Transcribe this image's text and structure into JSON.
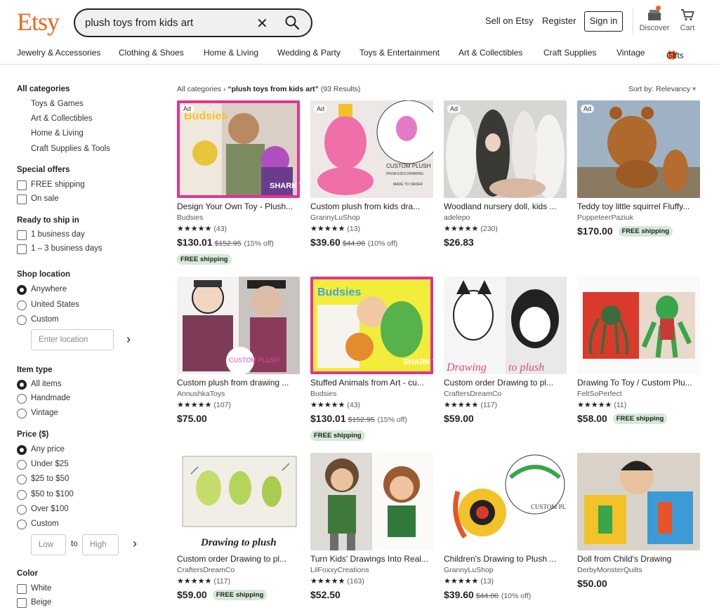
{
  "header": {
    "logo": "Etsy",
    "search_value": "plush toys from kids art",
    "sell": "Sell on Etsy",
    "register": "Register",
    "signin": "Sign in",
    "discover": "Discover",
    "cart": "Cart"
  },
  "catnav": [
    "Jewelry & Accessories",
    "Clothing & Shoes",
    "Home & Living",
    "Wedding & Party",
    "Toys & Entertainment",
    "Art & Collectibles",
    "Craft Supplies",
    "Vintage",
    "Gifts"
  ],
  "sidebar": {
    "all_categories": "All categories",
    "categories": [
      "Toys & Games",
      "Art & Collectibles",
      "Home & Living",
      "Craft Supplies & Tools"
    ],
    "special_offers": "Special offers",
    "offers": [
      "FREE shipping",
      "On sale"
    ],
    "ready_to_ship": "Ready to ship in",
    "ship_opts": [
      "1 business day",
      "1 – 3 business days"
    ],
    "shop_location": "Shop location",
    "locations": [
      "Anywhere",
      "United States",
      "Custom"
    ],
    "location_placeholder": "Enter location",
    "item_type": "Item type",
    "types": [
      "All items",
      "Handmade",
      "Vintage"
    ],
    "price": "Price ($)",
    "prices": [
      "Any price",
      "Under $25",
      "$25 to $50",
      "$50 to $100",
      "Over $100",
      "Custom"
    ],
    "low_placeholder": "Low",
    "to": "to",
    "high_placeholder": "High",
    "color": "Color",
    "colors": [
      "White",
      "Beige"
    ]
  },
  "results": {
    "crumb_root": "All categories",
    "crumb_query": "“plush toys from kids art”",
    "crumb_count": "(93 Results)",
    "sort": "Sort by: Relevancy"
  },
  "products": [
    {
      "ad": true,
      "title": "Design Your Own Toy - Plush...",
      "shop": "Budsies",
      "stars": "★★★★★",
      "reviews": "(43)",
      "price": "$130.01",
      "orig": "$152.95",
      "off": "(15% off)",
      "free": true,
      "free_below": true
    },
    {
      "ad": true,
      "title": "Custom plush from kids dra...",
      "shop": "GrannyLuShop",
      "stars": "★★★★★",
      "reviews": "(13)",
      "price": "$39.60",
      "orig": "$44.00",
      "off": "(10% off)",
      "free": false
    },
    {
      "ad": true,
      "title": "Woodland nursery doll, kids ...",
      "shop": "adelepo",
      "stars": "★★★★★",
      "reviews": "(230)",
      "price": "$26.83",
      "orig": "",
      "off": "",
      "free": false
    },
    {
      "ad": true,
      "title": "Teddy toy little squirrel Fluffy...",
      "shop": "PuppeteerPaziuk",
      "stars": "",
      "reviews": "",
      "price": "$170.00",
      "orig": "",
      "off": "",
      "free": true,
      "free_below": false
    },
    {
      "ad": false,
      "title": "Custom plush from drawing ...",
      "shop": "AnnushkaToys",
      "stars": "★★★★★",
      "reviews": "(107)",
      "price": "$75.00",
      "orig": "",
      "off": "",
      "free": false
    },
    {
      "ad": false,
      "title": "Stuffed Animals from Art - cu...",
      "shop": "Budsies",
      "stars": "★★★★★",
      "reviews": "(43)",
      "price": "$130.01",
      "orig": "$152.95",
      "off": "(15% off)",
      "free": true,
      "free_below": true
    },
    {
      "ad": false,
      "title": "Custom order Drawing to pl...",
      "shop": "CraftersDreamCo",
      "stars": "★★★★★",
      "reviews": "(117)",
      "price": "$59.00",
      "orig": "",
      "off": "",
      "free": false
    },
    {
      "ad": false,
      "title": "Drawing To Toy / Custom Plu...",
      "shop": "FeltSoPerfect",
      "stars": "★★★★★",
      "reviews": "(11)",
      "price": "$58.00",
      "orig": "",
      "off": "",
      "free": true,
      "free_below": false
    },
    {
      "ad": false,
      "title": "Custom order Drawing to pl...",
      "shop": "CraftersDreamCo",
      "stars": "★★★★★",
      "reviews": "(117)",
      "price": "$59.00",
      "orig": "",
      "off": "",
      "free": true,
      "free_below": false
    },
    {
      "ad": false,
      "title": "Turn Kids' Drawings Into Real...",
      "shop": "LilFoxxyCreations",
      "stars": "★★★★★",
      "reviews": "(163)",
      "price": "$52.50",
      "orig": "",
      "off": "",
      "free": false
    },
    {
      "ad": false,
      "title": "Children's Drawing to Plush ...",
      "shop": "GrannyLuShop",
      "stars": "★★★★★",
      "reviews": "(13)",
      "price": "$39.60",
      "orig": "$44.00",
      "off": "(10% off)",
      "free": false
    },
    {
      "ad": false,
      "title": "Doll from Child's Drawing",
      "shop": "DerbyMonsterQuilts",
      "stars": "",
      "reviews": "",
      "price": "$50.00",
      "orig": "",
      "off": "",
      "free": false
    }
  ],
  "free_shipping_label": "FREE shipping",
  "ad_label": "Ad",
  "image_text": {
    "budsies": "Budsies",
    "shark_tank": "SHARK TANK",
    "custom_plush": "CUSTOM PLUSH",
    "from_kids_drawing": "FROM KIDS DRAWING",
    "made_to_order": "MADE TO ORDER",
    "custom_plush_2": "CUSTOM PLUSH",
    "drawing": "Drawing",
    "to_plush": "to plush",
    "drawing_to_plush": "Drawing to plush",
    "custom_plush_3": "CUSTOM PLUSH FROM KIDS DRAWING"
  },
  "colors": {
    "brand": "#F1641E",
    "free_badge": "#d4e9d7"
  }
}
